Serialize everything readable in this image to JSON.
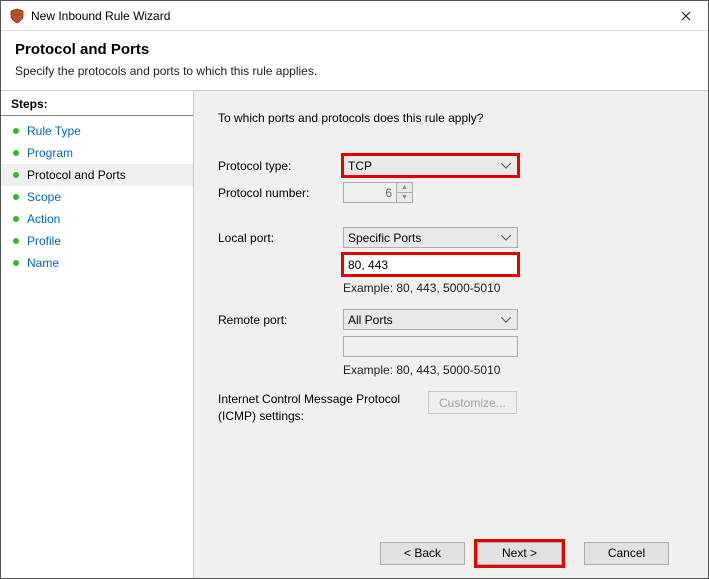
{
  "window": {
    "title": "New Inbound Rule Wizard"
  },
  "header": {
    "title": "Protocol and Ports",
    "subtitle": "Specify the protocols and ports to which this rule applies."
  },
  "steps": {
    "header": "Steps:",
    "items": [
      {
        "label": "Rule Type"
      },
      {
        "label": "Program"
      },
      {
        "label": "Protocol and Ports"
      },
      {
        "label": "Scope"
      },
      {
        "label": "Action"
      },
      {
        "label": "Profile"
      },
      {
        "label": "Name"
      }
    ],
    "current_index": 2
  },
  "content": {
    "question": "To which ports and protocols does this rule apply?",
    "protocol_type_label": "Protocol type:",
    "protocol_type_value": "TCP",
    "protocol_number_label": "Protocol number:",
    "protocol_number_value": "6",
    "local_port_label": "Local port:",
    "local_port_mode": "Specific Ports",
    "local_port_value": "80, 443",
    "local_port_example": "Example: 80, 443, 5000-5010",
    "remote_port_label": "Remote port:",
    "remote_port_mode": "All Ports",
    "remote_port_value": "",
    "remote_port_example": "Example: 80, 443, 5000-5010",
    "icmp_label": "Internet Control Message Protocol (ICMP) settings:",
    "customize_label": "Customize..."
  },
  "footer": {
    "back": "< Back",
    "next": "Next >",
    "cancel": "Cancel"
  }
}
